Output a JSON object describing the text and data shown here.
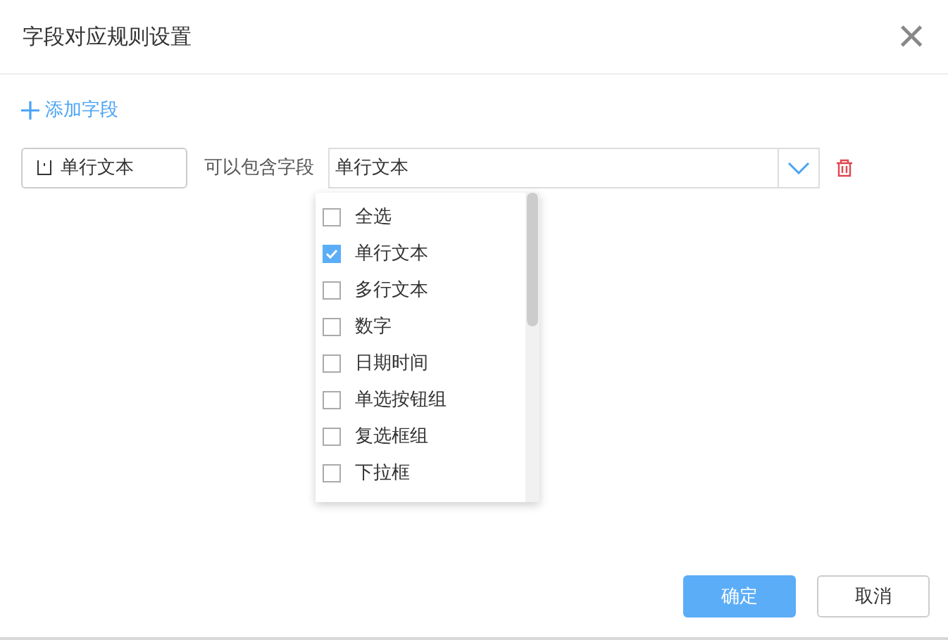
{
  "dialog": {
    "title": "字段对应规则设置",
    "close": "×"
  },
  "add_field": "添加字段",
  "rule": {
    "field": "单行文本",
    "label": "可以包含字段",
    "select_value": "单行文本"
  },
  "options": [
    {
      "label": "全选",
      "checked": false
    },
    {
      "label": "单行文本",
      "checked": true
    },
    {
      "label": "多行文本",
      "checked": false
    },
    {
      "label": "数字",
      "checked": false
    },
    {
      "label": "日期时间",
      "checked": false
    },
    {
      "label": "单选按钮组",
      "checked": false
    },
    {
      "label": "复选框组",
      "checked": false
    },
    {
      "label": "下拉框",
      "checked": false
    }
  ],
  "buttons": [
    {
      "label": "确定",
      "kind": "primary"
    },
    {
      "label": "取消",
      "kind": "default"
    }
  ]
}
